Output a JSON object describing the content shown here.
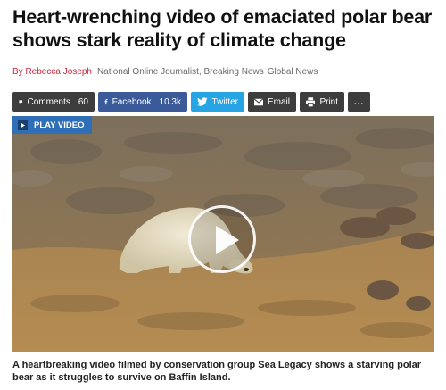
{
  "article": {
    "headline": "Heart-wrenching video of emaciated polar bear shows stark reality of climate change",
    "byline": {
      "prefix": "By",
      "author": "Rebecca Joseph",
      "role": "National Online Journalist, Breaking News",
      "outlet": "Global News"
    },
    "caption": "A heartbreaking video filmed by conservation group Sea Legacy shows a starving polar bear as it struggles to survive on Baffin Island."
  },
  "share": {
    "comments_label": "Comments",
    "comments_count": "60",
    "facebook_label": "Facebook",
    "facebook_count": "10.3k",
    "twitter_label": "Twitter",
    "email_label": "Email",
    "print_label": "Print",
    "more_label": "..."
  },
  "video": {
    "play_label": "PLAY VIDEO",
    "badge_color": "#2f6fb7"
  },
  "colors": {
    "author": "#c8283c",
    "facebook": "#3b5a9a",
    "twitter": "#27a4e4",
    "dark_button": "#3d3d3d"
  },
  "icons": [
    "comment-icon",
    "facebook-icon",
    "twitter-icon",
    "email-icon",
    "print-icon",
    "more-icon",
    "play-icon"
  ]
}
